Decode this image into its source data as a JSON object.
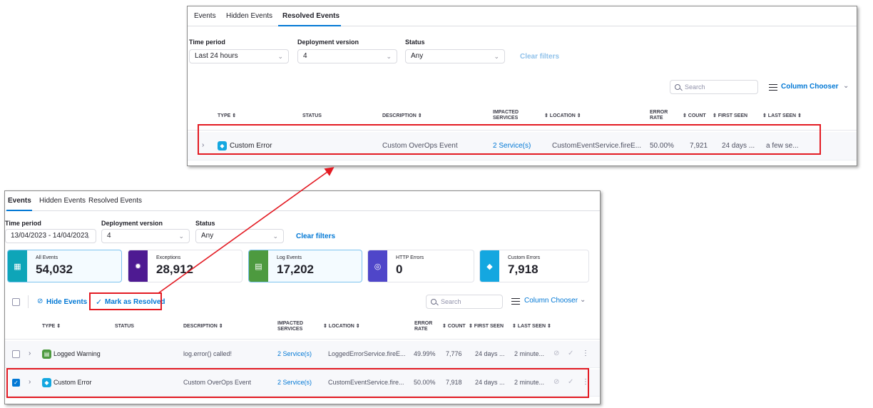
{
  "top": {
    "tabs": [
      "Events",
      "Hidden Events",
      "Resolved Events"
    ],
    "filters": {
      "time_label": "Time period",
      "time_value": "Last 24 hours",
      "deploy_label": "Deployment version",
      "deploy_value": "4",
      "status_label": "Status",
      "status_value": "Any",
      "clear": "Clear filters"
    },
    "search_placeholder": "Search",
    "column_chooser": "Column Chooser",
    "headers": {
      "type": "TYPE ⇕",
      "status": "STATUS",
      "description": "DESCRIPTION ⇕",
      "impacted1": "IMPACTED",
      "impacted2": "SERVICES",
      "location": "⇕ LOCATION ⇕",
      "error1": "ERROR",
      "error2": "RATE",
      "count": "⇕ COUNT",
      "first_seen": "⇕ FIRST SEEN",
      "last_seen": "⇕ LAST SEEN ⇕"
    },
    "row": {
      "type": "Custom Error",
      "description": "Custom OverOps Event",
      "services": "2 Service(s)",
      "location": "CustomEventService.fireE...",
      "error_rate": "50.00%",
      "count": "7,921",
      "first_seen": "24 days ...",
      "last_seen": "a few se..."
    }
  },
  "bottom": {
    "tabs": [
      "Events",
      "Hidden Events",
      "Resolved Events"
    ],
    "filters": {
      "time_label": "Time period",
      "time_value": "13/04/2023 - 14/04/2023",
      "deploy_label": "Deployment version",
      "deploy_value": "4",
      "status_label": "Status",
      "status_value": "Any",
      "clear": "Clear filters"
    },
    "cards": [
      {
        "label": "All Events",
        "value": "54,032",
        "color": "#0ea5b8"
      },
      {
        "label": "Exceptions",
        "value": "28,912",
        "color": "#4e1a92"
      },
      {
        "label": "Log Events",
        "value": "17,202",
        "color": "#4d9a3f"
      },
      {
        "label": "HTTP Errors",
        "value": "0",
        "color": "#4f46c9"
      },
      {
        "label": "Custom Errors",
        "value": "7,918",
        "color": "#14a7e0"
      }
    ],
    "hide_events": "Hide Events",
    "mark_resolved": "Mark as Resolved",
    "search_placeholder": "Search",
    "column_chooser": "Column Chooser",
    "headers": {
      "type": "TYPE ⇕",
      "status": "STATUS",
      "description": "DESCRIPTION ⇕",
      "impacted1": "IMPACTED",
      "impacted2": "SERVICES",
      "location": "⇕ LOCATION ⇕",
      "error1": "ERROR",
      "error2": "RATE",
      "count": "⇕ COUNT",
      "first_seen": "⇕ FIRST SEEN",
      "last_seen": "⇕ LAST SEEN ⇕"
    },
    "rows": [
      {
        "type": "Logged Warning",
        "description": "log.error() called!",
        "services": "2 Service(s)",
        "location": "LoggedErrorService.fireE...",
        "error_rate": "49.99%",
        "count": "7,776",
        "first_seen": "24 days ...",
        "last_seen": "2 minute...",
        "checked": false
      },
      {
        "type": "Custom Error",
        "description": "Custom OverOps Event",
        "services": "2 Service(s)",
        "location": "CustomEventService.fire...",
        "error_rate": "50.00%",
        "count": "7,918",
        "first_seen": "24 days ...",
        "last_seen": "2 minute...",
        "checked": true
      }
    ]
  },
  "colors": {
    "accent": "#0278d5",
    "highlight": "#e31b23"
  }
}
